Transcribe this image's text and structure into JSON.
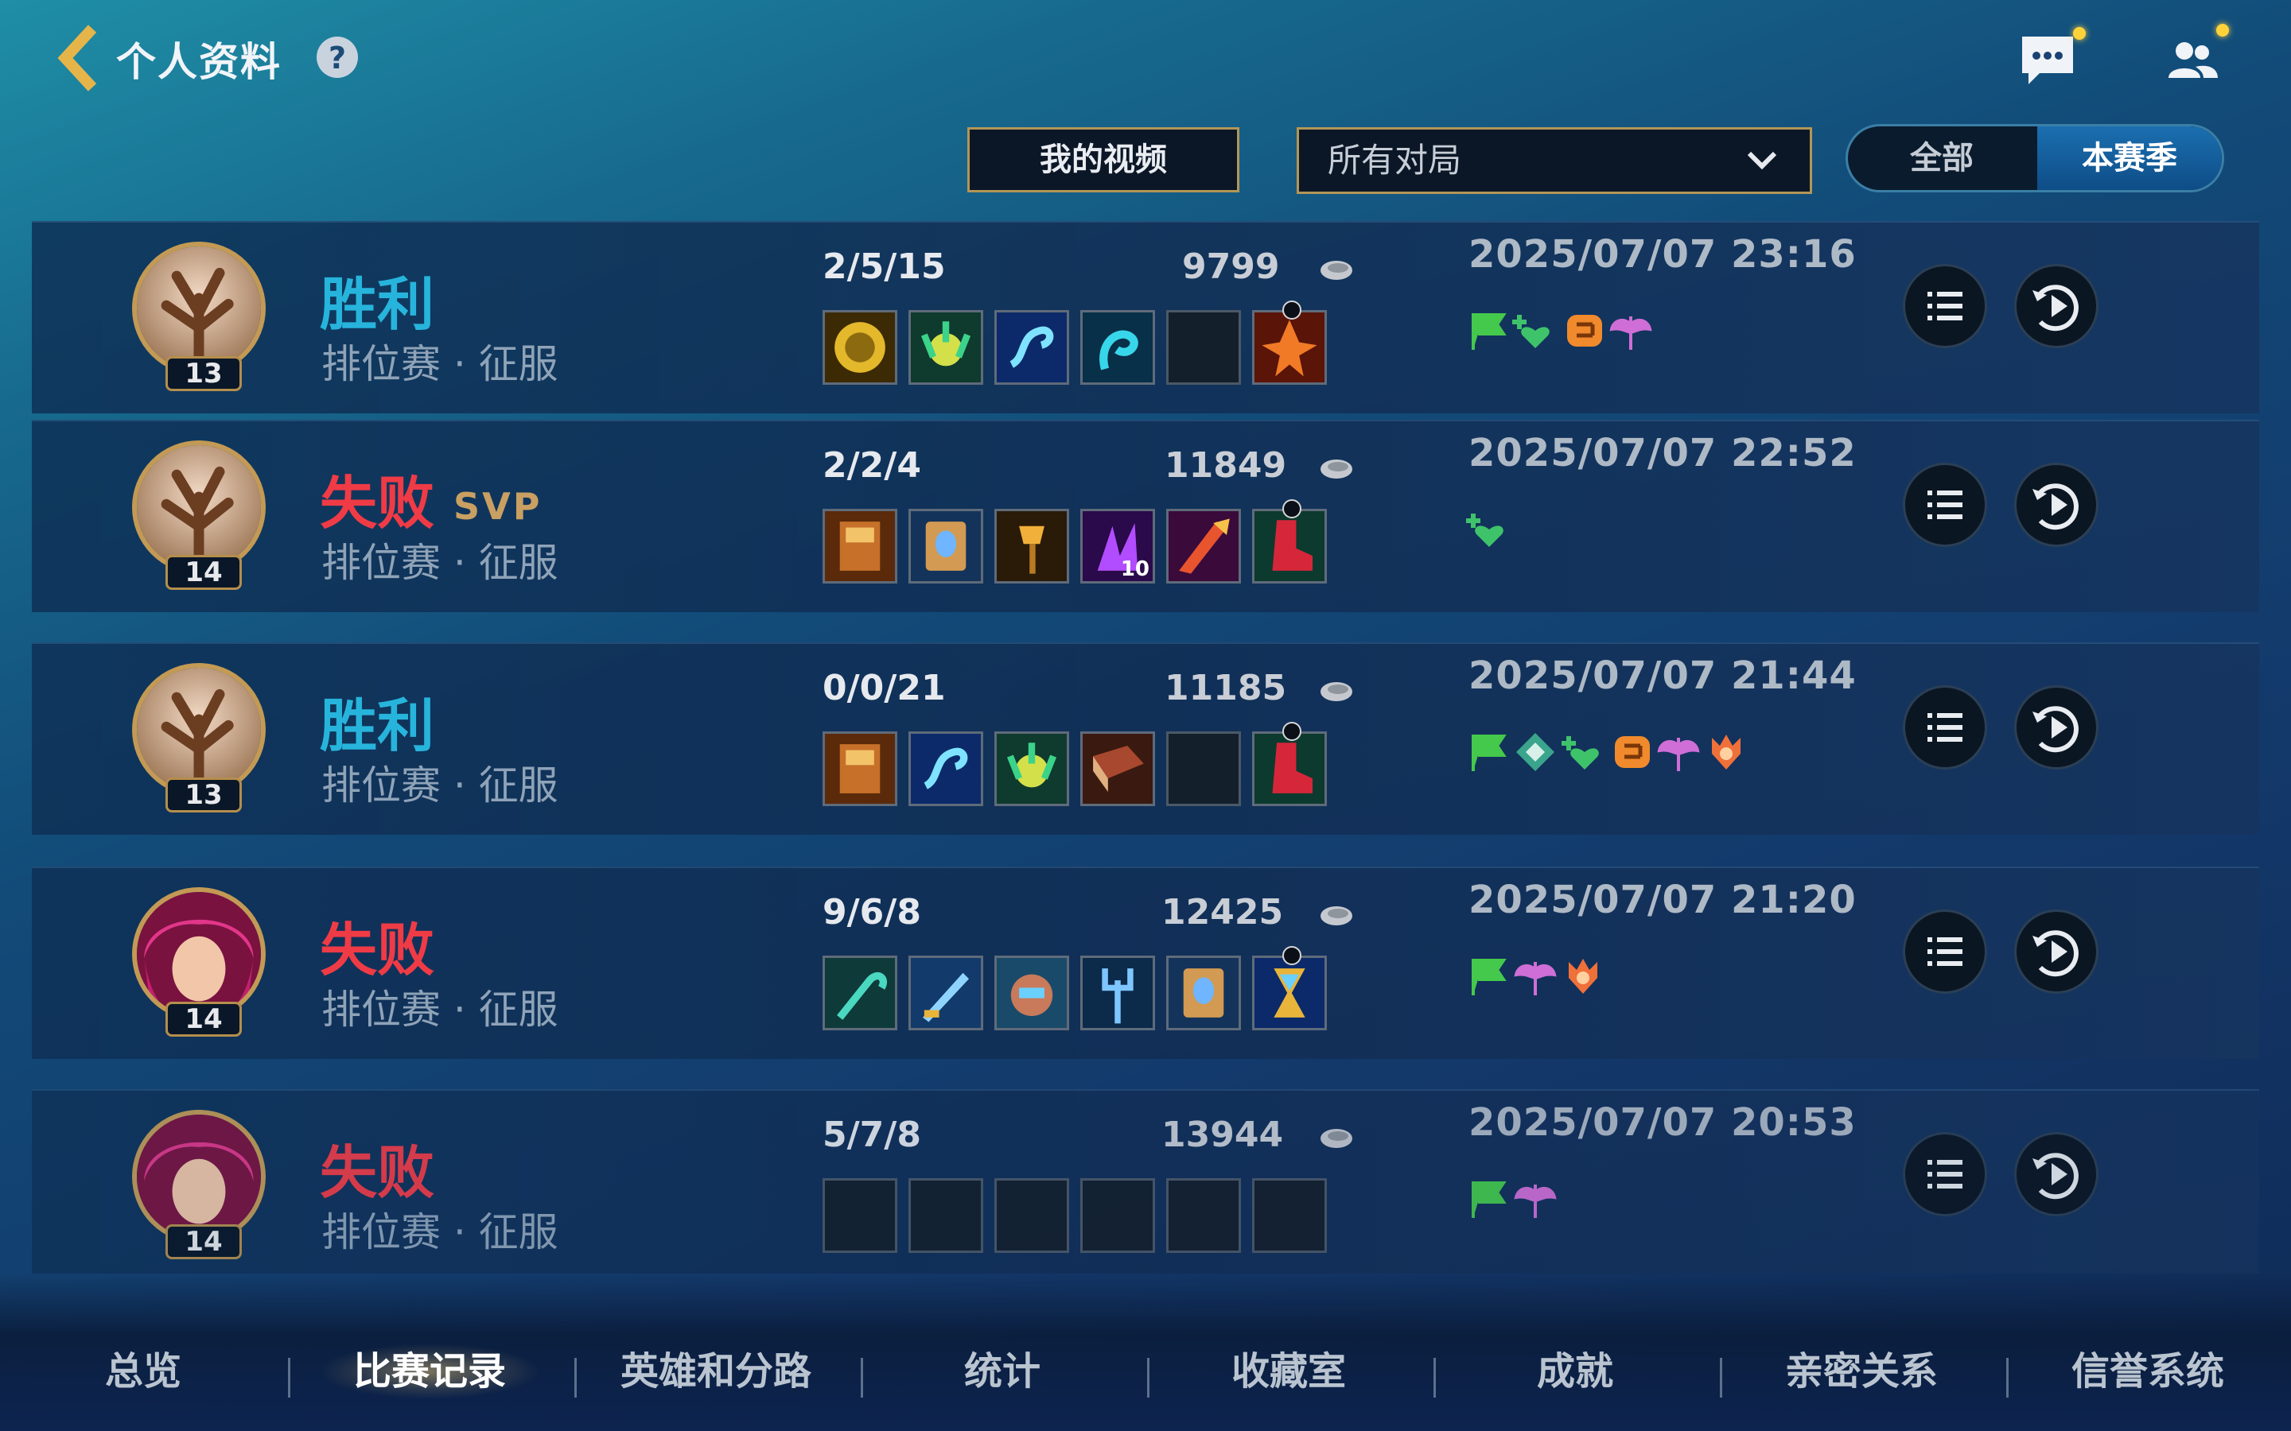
{
  "header": {
    "title": "个人资料",
    "help": "?"
  },
  "filters": {
    "video_button": "我的视频",
    "match_filter": "所有对局",
    "scope_all": "全部",
    "scope_season": "本赛季"
  },
  "matches": [
    {
      "result": "胜利",
      "svp": "",
      "mode": "排位赛 · 征服",
      "level": "13",
      "kda": "2/5/15",
      "gold": "9799",
      "datetime": "2025/07/07 23:16"
    },
    {
      "result": "失败",
      "svp": "SVP",
      "mode": "排位赛 · 征服",
      "level": "14",
      "kda": "2/2/4",
      "gold": "11849",
      "datetime": "2025/07/07 22:52"
    },
    {
      "result": "胜利",
      "svp": "",
      "mode": "排位赛 · 征服",
      "level": "13",
      "kda": "0/0/21",
      "gold": "11185",
      "datetime": "2025/07/07 21:44"
    },
    {
      "result": "失败",
      "svp": "",
      "mode": "排位赛 · 征服",
      "level": "14",
      "kda": "9/6/8",
      "gold": "12425",
      "datetime": "2025/07/07 21:20"
    },
    {
      "result": "失败",
      "svp": "",
      "mode": "排位赛 · 征服",
      "level": "14",
      "kda": "5/7/8",
      "gold": "13944",
      "datetime": "2025/07/07 20:53"
    }
  ],
  "item_stack_label": "10",
  "tabs": [
    "总览",
    "比赛记录",
    "英雄和分路",
    "统计",
    "收藏室",
    "成就",
    "亲密关系",
    "信誉系统"
  ],
  "active_tab": "比赛记录",
  "colors": {
    "win": "#27b4dc",
    "loss": "#ef3b46",
    "svp": "#c9a062",
    "gold_border": "#b39656"
  }
}
